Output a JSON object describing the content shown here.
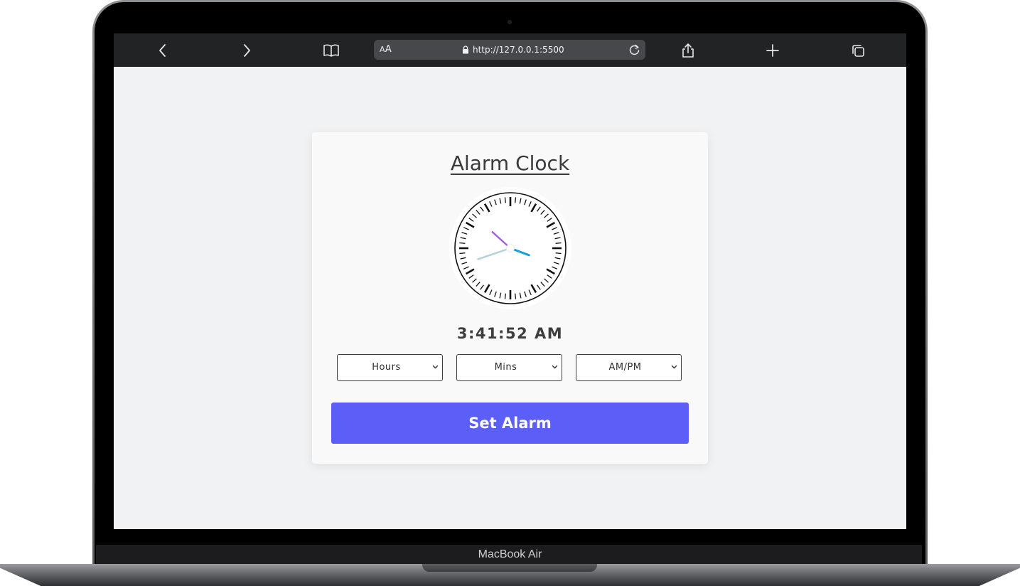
{
  "browser": {
    "url": "http://127.0.0.1:5500",
    "reader_label_small": "A",
    "reader_label_large": "A",
    "icons": {
      "back": "chevron-left-icon",
      "forward": "chevron-right-icon",
      "bookmarks": "book-icon",
      "lock": "lock-icon",
      "reload": "reload-icon",
      "share": "share-icon",
      "new_tab": "plus-icon",
      "tabs": "tabs-icon"
    }
  },
  "app": {
    "title": "Alarm Clock",
    "digital_time": "3:41:52 AM",
    "analog_time": {
      "hours": 3,
      "minutes": 41,
      "seconds": 52
    },
    "hand_colors": {
      "hour": "#1a9cd8",
      "minute": "#b7cfd9",
      "second": "#a45ee0"
    },
    "selects": {
      "hours": "Hours",
      "mins": "Mins",
      "ampm": "AM/PM"
    },
    "button": "Set Alarm",
    "accent": "#5b5ff8"
  },
  "device": {
    "label": "MacBook Air"
  }
}
